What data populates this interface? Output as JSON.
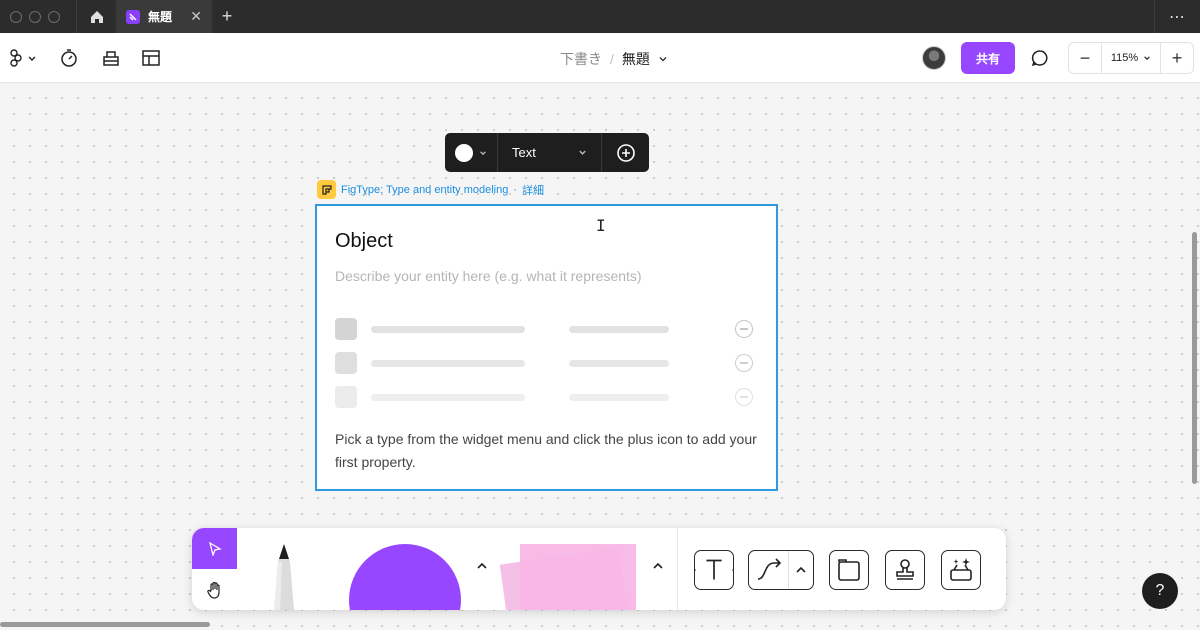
{
  "titlebar": {
    "tab_title": "無題",
    "close_glyph": "✕",
    "new_tab_glyph": "+",
    "more_glyph": "⋯"
  },
  "toolbar": {
    "breadcrumb_parent": "下書き",
    "breadcrumb_separator": "/",
    "file_title": "無題",
    "share_label": "共有",
    "zoom_value": "115%",
    "zoom_out_glyph": "−",
    "zoom_in_glyph": "+"
  },
  "widget_toolbar": {
    "text_type": "Text",
    "color_value": "#ffffff"
  },
  "widget": {
    "plugin_name": "FigType: Type and entity modeling",
    "details_separator": "·",
    "details_label": "詳細",
    "title": "Object",
    "description_placeholder": "Describe your entity here (e.g. what it represents)",
    "hint": "Pick a type from the widget menu and click the plus icon to add your first property."
  },
  "help": {
    "glyph": "?"
  },
  "colors": {
    "accent": "#9747ff",
    "selection": "#2f9ae0",
    "link": "#1a8fe0",
    "sticky": "#f8b6e6"
  }
}
